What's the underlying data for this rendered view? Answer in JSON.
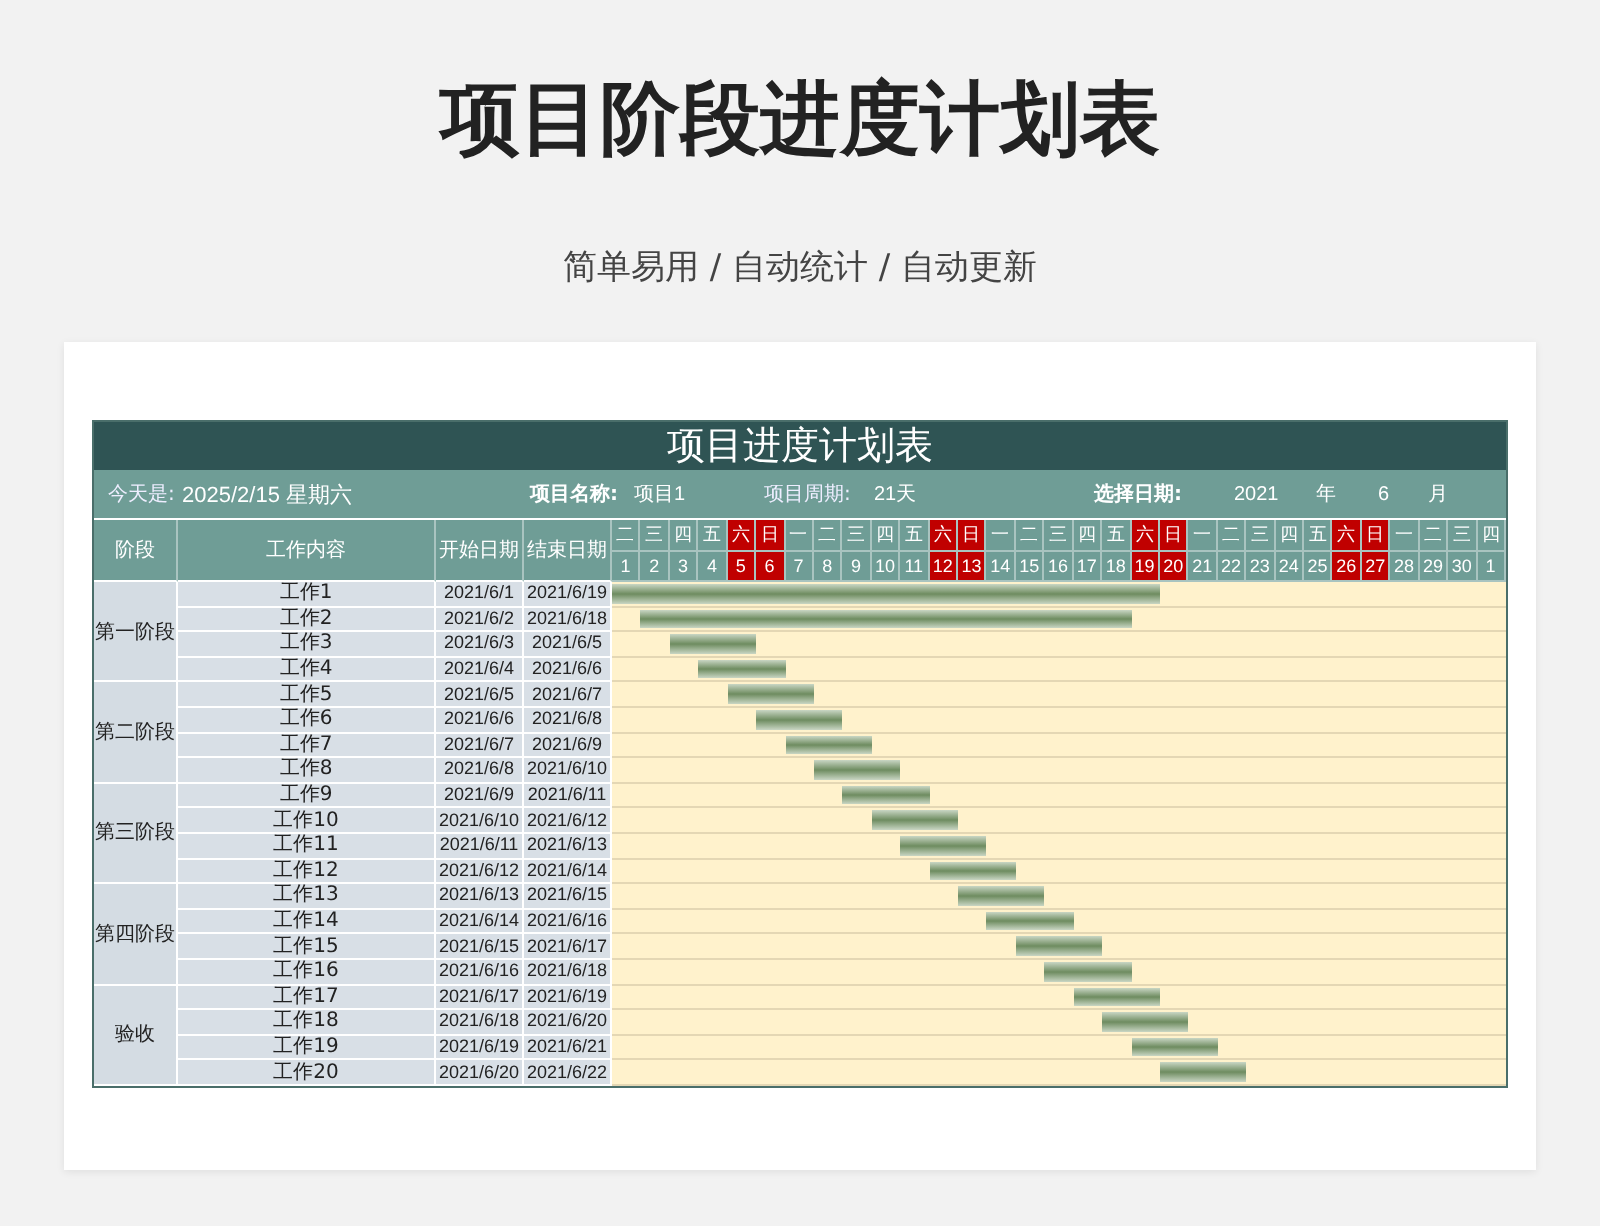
{
  "page_title": "项目阶段进度计划表",
  "subtitle": "简单易用 / 自动统计 / 自动更新",
  "sheet": {
    "title": "项目进度计划表",
    "info": [
      {
        "kind": "label",
        "text": "今天是:"
      },
      {
        "kind": "value",
        "text": "2025/2/15 星期六"
      },
      {
        "kind": "key",
        "text": "项目名称:"
      },
      {
        "kind": "value",
        "text": "项目1"
      },
      {
        "kind": "label",
        "text": "项目周期:"
      },
      {
        "kind": "value",
        "text": "21天"
      },
      {
        "kind": "key",
        "text": "选择日期:"
      },
      {
        "kind": "value",
        "text": "2021"
      },
      {
        "kind": "value",
        "text": "年"
      },
      {
        "kind": "value",
        "text": "6"
      },
      {
        "kind": "value",
        "text": "月"
      }
    ],
    "columns": [
      "阶段",
      "工作内容",
      "开始日期",
      "结束日期"
    ],
    "days": [
      {
        "weekday": "二",
        "day": "1",
        "weekend": false
      },
      {
        "weekday": "三",
        "day": "2",
        "weekend": false
      },
      {
        "weekday": "四",
        "day": "3",
        "weekend": false
      },
      {
        "weekday": "五",
        "day": "4",
        "weekend": false
      },
      {
        "weekday": "六",
        "day": "5",
        "weekend": true
      },
      {
        "weekday": "日",
        "day": "6",
        "weekend": true
      },
      {
        "weekday": "一",
        "day": "7",
        "weekend": false
      },
      {
        "weekday": "二",
        "day": "8",
        "weekend": false
      },
      {
        "weekday": "三",
        "day": "9",
        "weekend": false
      },
      {
        "weekday": "四",
        "day": "10",
        "weekend": false
      },
      {
        "weekday": "五",
        "day": "11",
        "weekend": false
      },
      {
        "weekday": "六",
        "day": "12",
        "weekend": true
      },
      {
        "weekday": "日",
        "day": "13",
        "weekend": true
      },
      {
        "weekday": "一",
        "day": "14",
        "weekend": false
      },
      {
        "weekday": "二",
        "day": "15",
        "weekend": false
      },
      {
        "weekday": "三",
        "day": "16",
        "weekend": false
      },
      {
        "weekday": "四",
        "day": "17",
        "weekend": false
      },
      {
        "weekday": "五",
        "day": "18",
        "weekend": false
      },
      {
        "weekday": "六",
        "day": "19",
        "weekend": true
      },
      {
        "weekday": "日",
        "day": "20",
        "weekend": true
      },
      {
        "weekday": "一",
        "day": "21",
        "weekend": false
      },
      {
        "weekday": "二",
        "day": "22",
        "weekend": false
      },
      {
        "weekday": "三",
        "day": "23",
        "weekend": false
      },
      {
        "weekday": "四",
        "day": "24",
        "weekend": false
      },
      {
        "weekday": "五",
        "day": "25",
        "weekend": false
      },
      {
        "weekday": "六",
        "day": "26",
        "weekend": true
      },
      {
        "weekday": "日",
        "day": "27",
        "weekend": true
      },
      {
        "weekday": "一",
        "day": "28",
        "weekend": false
      },
      {
        "weekday": "二",
        "day": "29",
        "weekend": false
      },
      {
        "weekday": "三",
        "day": "30",
        "weekend": false
      },
      {
        "weekday": "四",
        "day": "1",
        "weekend": false
      }
    ],
    "stages": [
      {
        "name": "第一阶段",
        "tasks": [
          {
            "name": "工作1",
            "start": "2021/6/1",
            "end": "2021/6/19"
          },
          {
            "name": "工作2",
            "start": "2021/6/2",
            "end": "2021/6/18"
          },
          {
            "name": "工作3",
            "start": "2021/6/3",
            "end": "2021/6/5"
          },
          {
            "name": "工作4",
            "start": "2021/6/4",
            "end": "2021/6/6"
          }
        ]
      },
      {
        "name": "第二阶段",
        "tasks": [
          {
            "name": "工作5",
            "start": "2021/6/5",
            "end": "2021/6/7"
          },
          {
            "name": "工作6",
            "start": "2021/6/6",
            "end": "2021/6/8"
          },
          {
            "name": "工作7",
            "start": "2021/6/7",
            "end": "2021/6/9"
          },
          {
            "name": "工作8",
            "start": "2021/6/8",
            "end": "2021/6/10"
          }
        ]
      },
      {
        "name": "第三阶段",
        "tasks": [
          {
            "name": "工作9",
            "start": "2021/6/9",
            "end": "2021/6/11"
          },
          {
            "name": "工作10",
            "start": "2021/6/10",
            "end": "2021/6/12"
          },
          {
            "name": "工作11",
            "start": "2021/6/11",
            "end": "2021/6/13"
          },
          {
            "name": "工作12",
            "start": "2021/6/12",
            "end": "2021/6/14"
          }
        ]
      },
      {
        "name": "第四阶段",
        "tasks": [
          {
            "name": "工作13",
            "start": "2021/6/13",
            "end": "2021/6/15"
          },
          {
            "name": "工作14",
            "start": "2021/6/14",
            "end": "2021/6/16"
          },
          {
            "name": "工作15",
            "start": "2021/6/15",
            "end": "2021/6/17"
          },
          {
            "name": "工作16",
            "start": "2021/6/16",
            "end": "2021/6/18"
          }
        ]
      },
      {
        "name": "验收",
        "tasks": [
          {
            "name": "工作17",
            "start": "2021/6/17",
            "end": "2021/6/19"
          },
          {
            "name": "工作18",
            "start": "2021/6/18",
            "end": "2021/6/20"
          },
          {
            "name": "工作19",
            "start": "2021/6/19",
            "end": "2021/6/21"
          },
          {
            "name": "工作20",
            "start": "2021/6/20",
            "end": "2021/6/22"
          }
        ]
      }
    ]
  }
}
